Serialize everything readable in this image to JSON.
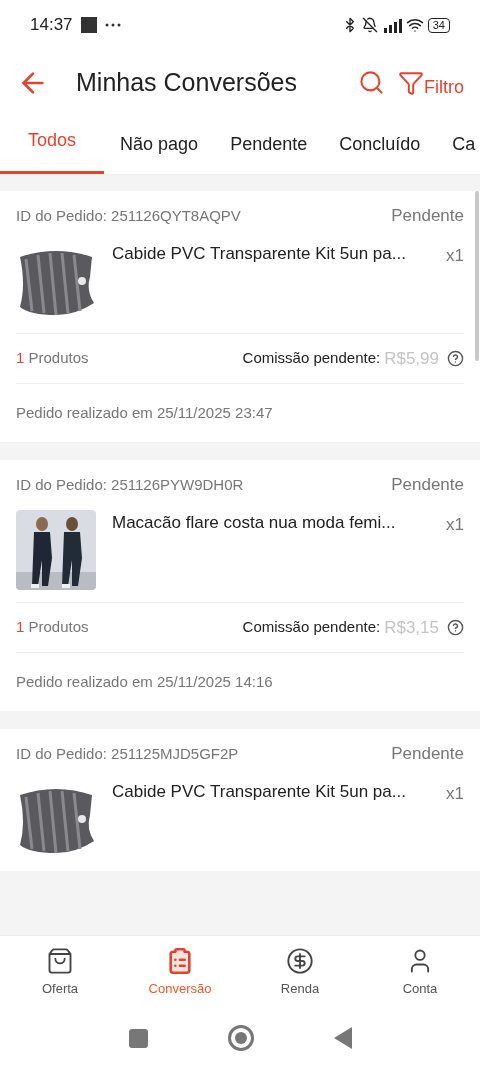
{
  "status_bar": {
    "time": "14:37",
    "battery": "34"
  },
  "header": {
    "title": "Minhas Conversões",
    "filter_label": "Filtro"
  },
  "tabs": [
    {
      "label": "Todos",
      "selected": true
    },
    {
      "label": "Não pago",
      "selected": false
    },
    {
      "label": "Pendente",
      "selected": false
    },
    {
      "label": "Concluído",
      "selected": false
    },
    {
      "label": "Ca",
      "selected": false
    }
  ],
  "orders": [
    {
      "order_id": "ID do Pedido: 251126QYT8AQPV",
      "status": "Pendente",
      "product": {
        "kind": "hangers",
        "name": "Cabide PVC Transparente Kit 5un pa...",
        "quantity": "x1"
      },
      "product_count": "1",
      "products_label": "Produtos",
      "commission_label": "Comissão pendente:",
      "commission": "R$5,99",
      "date": "Pedido realizado em 25/11/2025 23:47"
    },
    {
      "order_id": "ID do Pedido: 251126PYW9DH0R",
      "status": "Pendente",
      "product": {
        "kind": "outfit",
        "name": "Macacão flare costa nua moda femi...",
        "quantity": "x1"
      },
      "product_count": "1",
      "products_label": "Produtos",
      "commission_label": "Comissão pendente:",
      "commission": "R$3,15",
      "date": "Pedido realizado em 25/11/2025 14:16"
    },
    {
      "order_id": "ID do Pedido: 251125MJD5GF2P",
      "status": "Pendente",
      "product": {
        "kind": "hangers",
        "name": "Cabide PVC Transparente Kit 5un pa...",
        "quantity": "x1"
      }
    }
  ],
  "bottom_nav": [
    {
      "label": "Oferta",
      "kind": "bag",
      "selected": false
    },
    {
      "label": "Conversão",
      "kind": "clipboard",
      "selected": true
    },
    {
      "label": "Renda",
      "kind": "dollar",
      "selected": false
    },
    {
      "label": "Conta",
      "kind": "user",
      "selected": false
    }
  ]
}
